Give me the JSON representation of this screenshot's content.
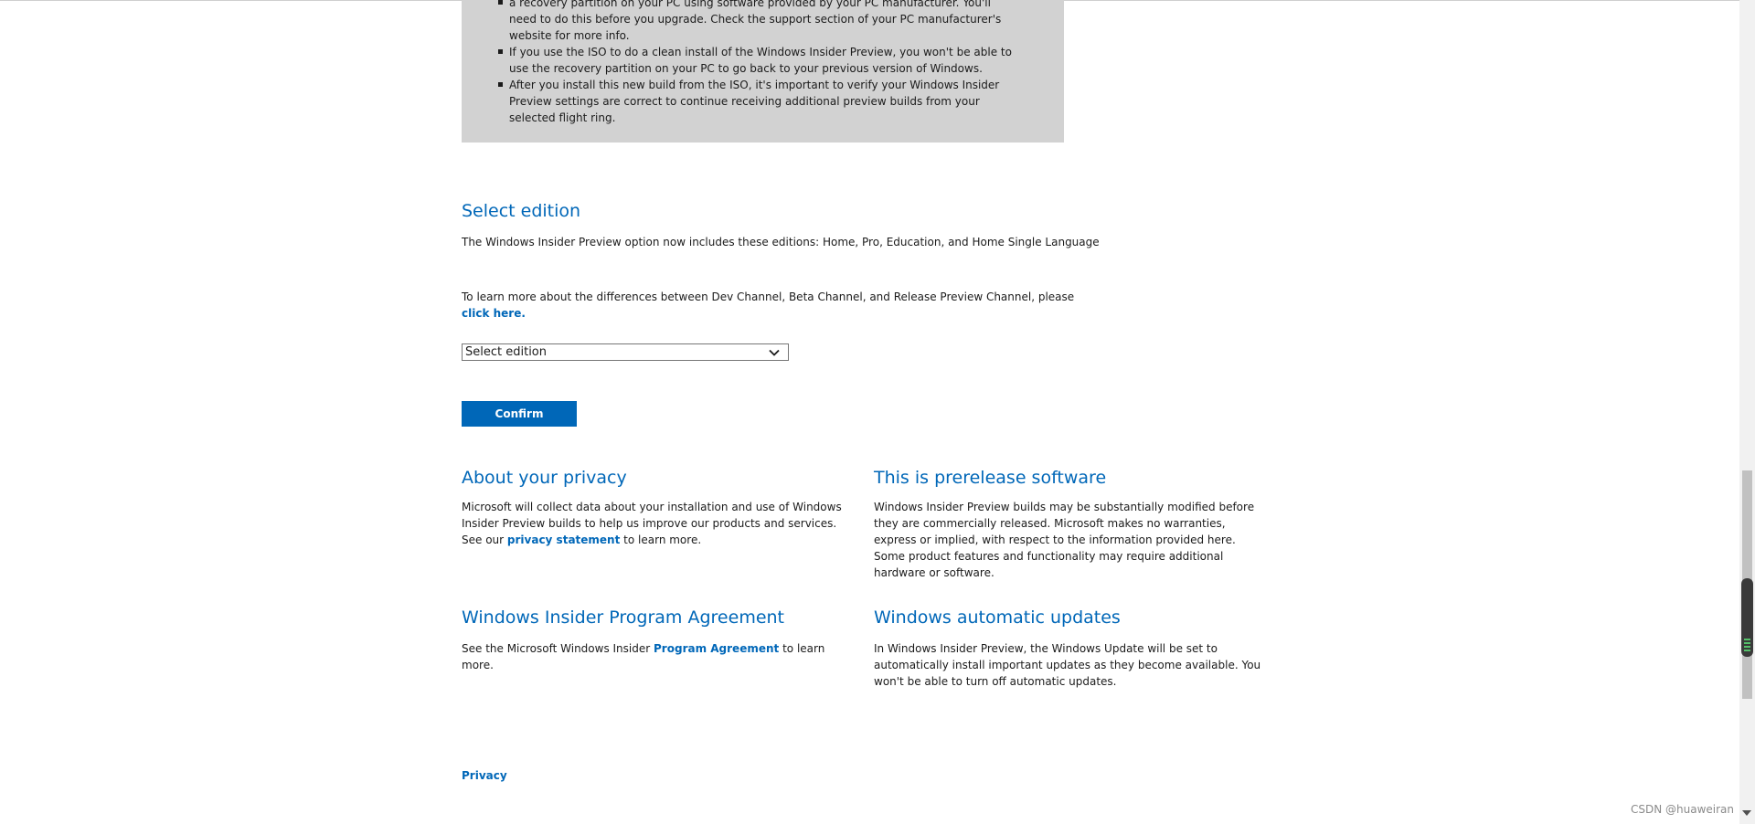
{
  "notice": {
    "items": [
      "a recovery partition on your PC using software provided by your PC manufacturer. You'll need to do this before you upgrade. Check the support section of your PC manufacturer's website for more info.",
      "If you use the ISO to do a clean install of the Windows Insider Preview, you won't be able to use the recovery partition on your PC to go back to your previous version of Windows.",
      "After you install this new build from the ISO, it's important to verify your Windows Insider Preview settings are correct to continue receiving additional preview builds from your selected flight ring."
    ]
  },
  "select_edition": {
    "heading": "Select edition",
    "editions_text": "The Windows Insider Preview option now includes these editions: Home, Pro, Education, and Home Single Language",
    "channels_text": "To learn more about the differences between Dev Channel, Beta Channel, and Release Preview Channel, please",
    "channels_link": "click here.",
    "dropdown_value": "Select edition",
    "confirm_label": "Confirm"
  },
  "privacy": {
    "heading": "About your privacy",
    "text_before": "Microsoft will collect data about your installation and use of Windows Insider Preview builds to help us improve our products and services. See our",
    "link": "privacy statement",
    "text_after": "to learn more."
  },
  "prerelease": {
    "heading": "This is prerelease software",
    "text": "Windows Insider Preview builds may be substantially modified before they are commercially released. Microsoft makes no warranties, express or implied, with respect to the information provided here. Some product features and functionality may require additional hardware or software."
  },
  "agreement": {
    "heading": "Windows Insider Program Agreement",
    "text_before": "See the Microsoft Windows Insider",
    "link": "Program Agreement",
    "text_after": "to learn more."
  },
  "updates": {
    "heading": "Windows automatic updates",
    "text": "In Windows Insider Preview, the Windows Update will be set to automatically install important updates as they become available. You won't be able to turn off automatic updates."
  },
  "footer": {
    "privacy_link": "Privacy"
  },
  "watermark": "CSDN @huaweiran"
}
